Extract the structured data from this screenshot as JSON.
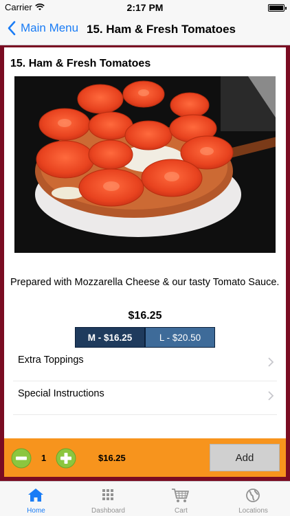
{
  "status": {
    "carrier": "Carrier",
    "time": "2:17 PM"
  },
  "nav": {
    "back_label": "Main Menu",
    "title": "15. Ham & Fresh Tomatoes"
  },
  "item": {
    "title": "15. Ham & Fresh Tomatoes",
    "description": "Prepared with Mozzarella Cheese & our tasty Tomato Sauce.",
    "price": "$16.25",
    "sizes": [
      {
        "label": "M - $16.25",
        "selected": true
      },
      {
        "label": "L - $20.50",
        "selected": false
      }
    ],
    "options": [
      {
        "label": "Extra Toppings"
      },
      {
        "label": "Special Instructions"
      }
    ]
  },
  "order": {
    "quantity": "1",
    "total": "$16.25",
    "add_label": "Add"
  },
  "tabs": [
    {
      "label": "Home",
      "icon": "home-icon",
      "active": true
    },
    {
      "label": "Dashboard",
      "icon": "grid-icon",
      "active": false
    },
    {
      "label": "Cart",
      "icon": "cart-icon",
      "active": false
    },
    {
      "label": "Locations",
      "icon": "globe-icon",
      "active": false
    }
  ],
  "colors": {
    "accent": "#1a7cf5",
    "frame": "#7a0c22",
    "order_bar": "#f7941d",
    "size_selected": "#1f3b5d",
    "size_unselected": "#3e6b99",
    "qty_button": "#8cc63f"
  }
}
